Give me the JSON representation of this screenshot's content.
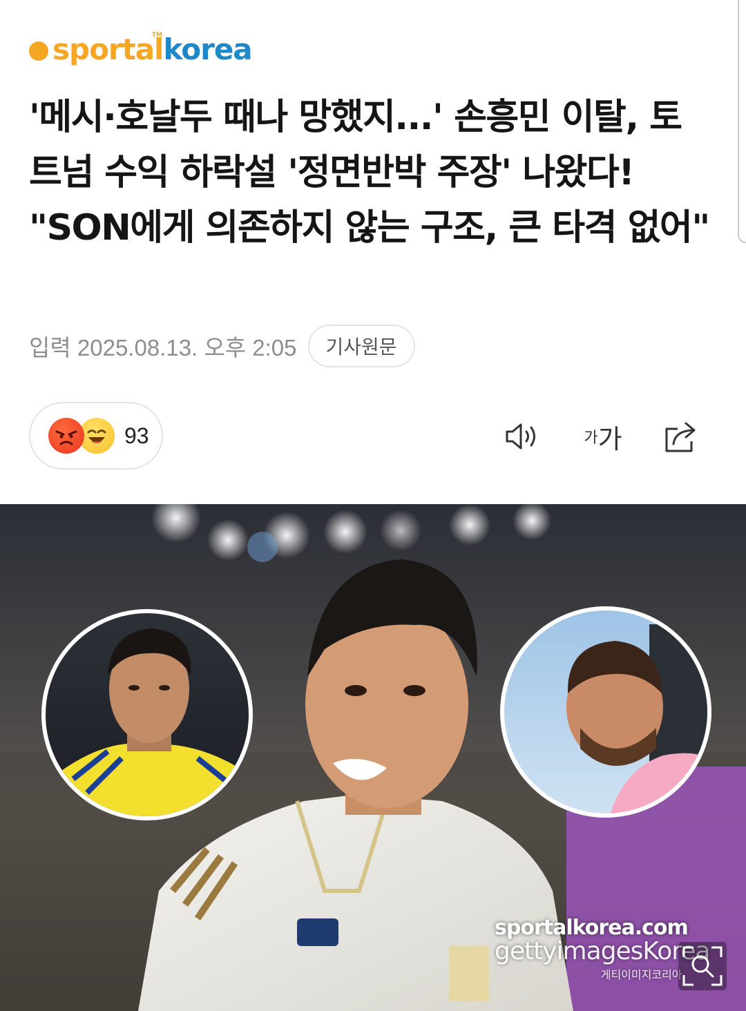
{
  "brand": {
    "logo_part1": "sportal",
    "logo_part2": "korea",
    "tm": "TM",
    "colors": {
      "orange": "#f5a623",
      "blue": "#1e88c9"
    }
  },
  "article": {
    "headline": "'메시·호날두 때나 망했지...' 손흥민 이탈, 토트넘 수익 하락설 '정면반박 주장' 나왔다! \"SON에게 의존하지 않는 구조, 큰 타격 없어\"",
    "published": "입력 2025.08.13. 오후 2:05",
    "source_button": "기사원문"
  },
  "reactions": {
    "count": "93",
    "icons": [
      "angry-emoji",
      "laughing-emoji"
    ]
  },
  "toolbar": {
    "icons": [
      "speaker-icon",
      "font-size-icon",
      "share-icon"
    ],
    "font_small": "가",
    "font_big": "가"
  },
  "photo": {
    "watermark_line1": "sportalkorea.com",
    "watermark_line2": "gettyimagesKorea",
    "watermark_line3": "게티이미지코리아",
    "zoom_icon": "zoom-icon"
  }
}
